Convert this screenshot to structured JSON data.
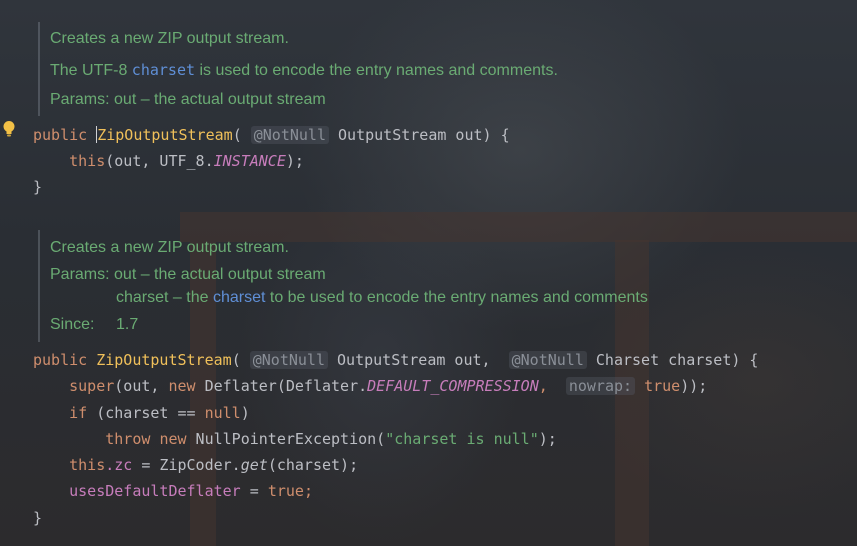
{
  "doc1": {
    "line1": "Creates a new ZIP output stream.",
    "line2_pre": "The UTF-8 ",
    "line2_link": "charset",
    "line2_post": " is used to encode the entry names and comments.",
    "line3": "Params: out – the actual output stream"
  },
  "ctor1": {
    "mod": "public",
    "name": "ZipOutputStream",
    "open": "(",
    "ann": "@NotNull",
    "params": " OutputStream out) {",
    "this_kw": "this",
    "body_mid": "(out, UTF_8.",
    "instance": "INSTANCE",
    "body_end": ");",
    "close": "}"
  },
  "doc2": {
    "line1": "Creates a new ZIP output stream.",
    "line2": "Params: out – the actual output stream",
    "line3_pre": "charset – the ",
    "line3_link": "charset",
    "line3_post": " to be used to encode the entry names and comments",
    "since_label": "Since:",
    "since_value": "1.7"
  },
  "ctor2": {
    "mod": "public",
    "name": "ZipOutputStream",
    "open": "(",
    "ann1": "@NotNull",
    "p1": " OutputStream out, ",
    "ann2": "@NotNull",
    "p2": " Charset charset) {",
    "super_kw": "super",
    "s_mid": "(out, ",
    "new_kw": "new",
    "s_mid2": " Deflater(Deflater.",
    "default_comp": "DEFAULT_COMPRESSION",
    "s_comma": ", ",
    "hint_nowrap": "nowrap:",
    "true_kw": "true",
    "s_end": "));",
    "if_kw": "if",
    "if_mid": " (charset ",
    "eq": "==",
    "null_kw": "null",
    "if_end": ")",
    "throw_kw": "throw",
    "new_kw2": "new",
    "npe": " NullPointerException(",
    "npe_str": "\"charset is null\"",
    "npe_end": ");",
    "this_kw": "this",
    "zc": ".zc",
    "zc_mid": " = ZipCoder.",
    "get": "get",
    "zc_end": "(charset);",
    "udd": "usesDefaultDeflater",
    "udd_mid": " = ",
    "true_kw2": "true",
    "udd_end": ";",
    "close": "}"
  },
  "colors": {
    "keyword": "#cf8e6d",
    "method": "#f0c05a",
    "doc": "#6aab73",
    "link": "#5f8fd6",
    "constant": "#c77dbb"
  },
  "icons": {
    "gutter": "lightbulb-icon"
  }
}
